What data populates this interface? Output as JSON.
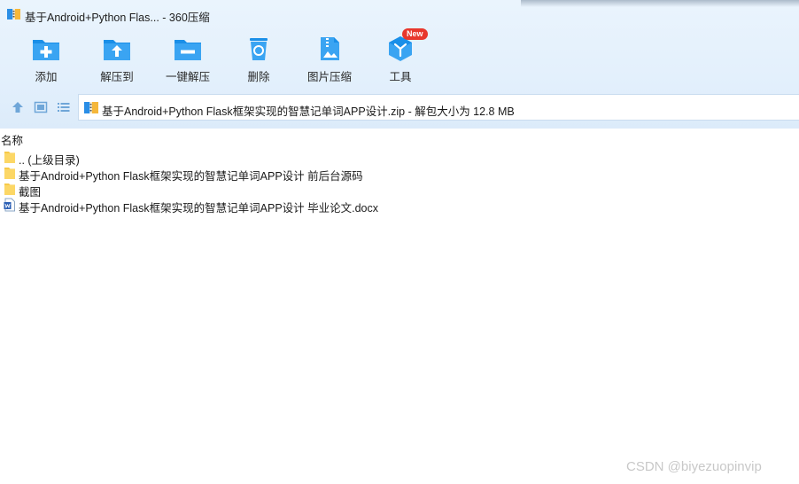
{
  "window": {
    "title": "基于Android+Python Flas... - 360压缩"
  },
  "toolbar": {
    "items": [
      {
        "id": "add",
        "label": "添加",
        "icon": "add-icon"
      },
      {
        "id": "extract-to",
        "label": "解压到",
        "icon": "extract-to-icon"
      },
      {
        "id": "one-click-extract",
        "label": "一键解压",
        "icon": "one-click-extract-icon"
      },
      {
        "id": "delete",
        "label": "删除",
        "icon": "recycle-bin-icon"
      },
      {
        "id": "image-compress",
        "label": "图片压缩",
        "icon": "image-compress-icon"
      },
      {
        "id": "tools",
        "label": "工具",
        "icon": "tools-icon"
      }
    ],
    "new_badge": "New"
  },
  "address": {
    "text": "基于Android+Python Flask框架实现的智慧记单词APP设计.zip - 解包大小为 12.8 MB"
  },
  "list": {
    "column_name": "名称",
    "items": [
      {
        "name": ".. (上级目录)",
        "type": "folder"
      },
      {
        "name": "基于Android+Python Flask框架实现的智慧记单词APP设计 前后台源码",
        "type": "folder"
      },
      {
        "name": "截图",
        "type": "folder"
      },
      {
        "name": "基于Android+Python Flask框架实现的智慧记单词APP设计 毕业论文.docx",
        "type": "docx"
      }
    ]
  },
  "watermark": "CSDN @biyezuopinvip",
  "colors": {
    "accent": "#1a8fe8",
    "folder": "#f7c948",
    "band": "#e3f0fc",
    "badge": "#e8372d"
  }
}
